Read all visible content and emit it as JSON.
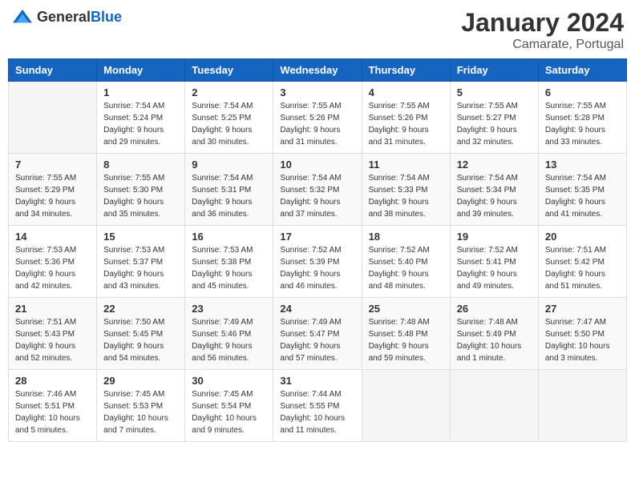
{
  "header": {
    "logo_general": "General",
    "logo_blue": "Blue",
    "month": "January 2024",
    "location": "Camarate, Portugal"
  },
  "days_of_week": [
    "Sunday",
    "Monday",
    "Tuesday",
    "Wednesday",
    "Thursday",
    "Friday",
    "Saturday"
  ],
  "weeks": [
    [
      {
        "day": "",
        "sunrise": "",
        "sunset": "",
        "daylight": ""
      },
      {
        "day": "1",
        "sunrise": "Sunrise: 7:54 AM",
        "sunset": "Sunset: 5:24 PM",
        "daylight": "Daylight: 9 hours and 29 minutes."
      },
      {
        "day": "2",
        "sunrise": "Sunrise: 7:54 AM",
        "sunset": "Sunset: 5:25 PM",
        "daylight": "Daylight: 9 hours and 30 minutes."
      },
      {
        "day": "3",
        "sunrise": "Sunrise: 7:55 AM",
        "sunset": "Sunset: 5:26 PM",
        "daylight": "Daylight: 9 hours and 31 minutes."
      },
      {
        "day": "4",
        "sunrise": "Sunrise: 7:55 AM",
        "sunset": "Sunset: 5:26 PM",
        "daylight": "Daylight: 9 hours and 31 minutes."
      },
      {
        "day": "5",
        "sunrise": "Sunrise: 7:55 AM",
        "sunset": "Sunset: 5:27 PM",
        "daylight": "Daylight: 9 hours and 32 minutes."
      },
      {
        "day": "6",
        "sunrise": "Sunrise: 7:55 AM",
        "sunset": "Sunset: 5:28 PM",
        "daylight": "Daylight: 9 hours and 33 minutes."
      }
    ],
    [
      {
        "day": "7",
        "sunrise": "Sunrise: 7:55 AM",
        "sunset": "Sunset: 5:29 PM",
        "daylight": "Daylight: 9 hours and 34 minutes."
      },
      {
        "day": "8",
        "sunrise": "Sunrise: 7:55 AM",
        "sunset": "Sunset: 5:30 PM",
        "daylight": "Daylight: 9 hours and 35 minutes."
      },
      {
        "day": "9",
        "sunrise": "Sunrise: 7:54 AM",
        "sunset": "Sunset: 5:31 PM",
        "daylight": "Daylight: 9 hours and 36 minutes."
      },
      {
        "day": "10",
        "sunrise": "Sunrise: 7:54 AM",
        "sunset": "Sunset: 5:32 PM",
        "daylight": "Daylight: 9 hours and 37 minutes."
      },
      {
        "day": "11",
        "sunrise": "Sunrise: 7:54 AM",
        "sunset": "Sunset: 5:33 PM",
        "daylight": "Daylight: 9 hours and 38 minutes."
      },
      {
        "day": "12",
        "sunrise": "Sunrise: 7:54 AM",
        "sunset": "Sunset: 5:34 PM",
        "daylight": "Daylight: 9 hours and 39 minutes."
      },
      {
        "day": "13",
        "sunrise": "Sunrise: 7:54 AM",
        "sunset": "Sunset: 5:35 PM",
        "daylight": "Daylight: 9 hours and 41 minutes."
      }
    ],
    [
      {
        "day": "14",
        "sunrise": "Sunrise: 7:53 AM",
        "sunset": "Sunset: 5:36 PM",
        "daylight": "Daylight: 9 hours and 42 minutes."
      },
      {
        "day": "15",
        "sunrise": "Sunrise: 7:53 AM",
        "sunset": "Sunset: 5:37 PM",
        "daylight": "Daylight: 9 hours and 43 minutes."
      },
      {
        "day": "16",
        "sunrise": "Sunrise: 7:53 AM",
        "sunset": "Sunset: 5:38 PM",
        "daylight": "Daylight: 9 hours and 45 minutes."
      },
      {
        "day": "17",
        "sunrise": "Sunrise: 7:52 AM",
        "sunset": "Sunset: 5:39 PM",
        "daylight": "Daylight: 9 hours and 46 minutes."
      },
      {
        "day": "18",
        "sunrise": "Sunrise: 7:52 AM",
        "sunset": "Sunset: 5:40 PM",
        "daylight": "Daylight: 9 hours and 48 minutes."
      },
      {
        "day": "19",
        "sunrise": "Sunrise: 7:52 AM",
        "sunset": "Sunset: 5:41 PM",
        "daylight": "Daylight: 9 hours and 49 minutes."
      },
      {
        "day": "20",
        "sunrise": "Sunrise: 7:51 AM",
        "sunset": "Sunset: 5:42 PM",
        "daylight": "Daylight: 9 hours and 51 minutes."
      }
    ],
    [
      {
        "day": "21",
        "sunrise": "Sunrise: 7:51 AM",
        "sunset": "Sunset: 5:43 PM",
        "daylight": "Daylight: 9 hours and 52 minutes."
      },
      {
        "day": "22",
        "sunrise": "Sunrise: 7:50 AM",
        "sunset": "Sunset: 5:45 PM",
        "daylight": "Daylight: 9 hours and 54 minutes."
      },
      {
        "day": "23",
        "sunrise": "Sunrise: 7:49 AM",
        "sunset": "Sunset: 5:46 PM",
        "daylight": "Daylight: 9 hours and 56 minutes."
      },
      {
        "day": "24",
        "sunrise": "Sunrise: 7:49 AM",
        "sunset": "Sunset: 5:47 PM",
        "daylight": "Daylight: 9 hours and 57 minutes."
      },
      {
        "day": "25",
        "sunrise": "Sunrise: 7:48 AM",
        "sunset": "Sunset: 5:48 PM",
        "daylight": "Daylight: 9 hours and 59 minutes."
      },
      {
        "day": "26",
        "sunrise": "Sunrise: 7:48 AM",
        "sunset": "Sunset: 5:49 PM",
        "daylight": "Daylight: 10 hours and 1 minute."
      },
      {
        "day": "27",
        "sunrise": "Sunrise: 7:47 AM",
        "sunset": "Sunset: 5:50 PM",
        "daylight": "Daylight: 10 hours and 3 minutes."
      }
    ],
    [
      {
        "day": "28",
        "sunrise": "Sunrise: 7:46 AM",
        "sunset": "Sunset: 5:51 PM",
        "daylight": "Daylight: 10 hours and 5 minutes."
      },
      {
        "day": "29",
        "sunrise": "Sunrise: 7:45 AM",
        "sunset": "Sunset: 5:53 PM",
        "daylight": "Daylight: 10 hours and 7 minutes."
      },
      {
        "day": "30",
        "sunrise": "Sunrise: 7:45 AM",
        "sunset": "Sunset: 5:54 PM",
        "daylight": "Daylight: 10 hours and 9 minutes."
      },
      {
        "day": "31",
        "sunrise": "Sunrise: 7:44 AM",
        "sunset": "Sunset: 5:55 PM",
        "daylight": "Daylight: 10 hours and 11 minutes."
      },
      {
        "day": "",
        "sunrise": "",
        "sunset": "",
        "daylight": ""
      },
      {
        "day": "",
        "sunrise": "",
        "sunset": "",
        "daylight": ""
      },
      {
        "day": "",
        "sunrise": "",
        "sunset": "",
        "daylight": ""
      }
    ]
  ]
}
